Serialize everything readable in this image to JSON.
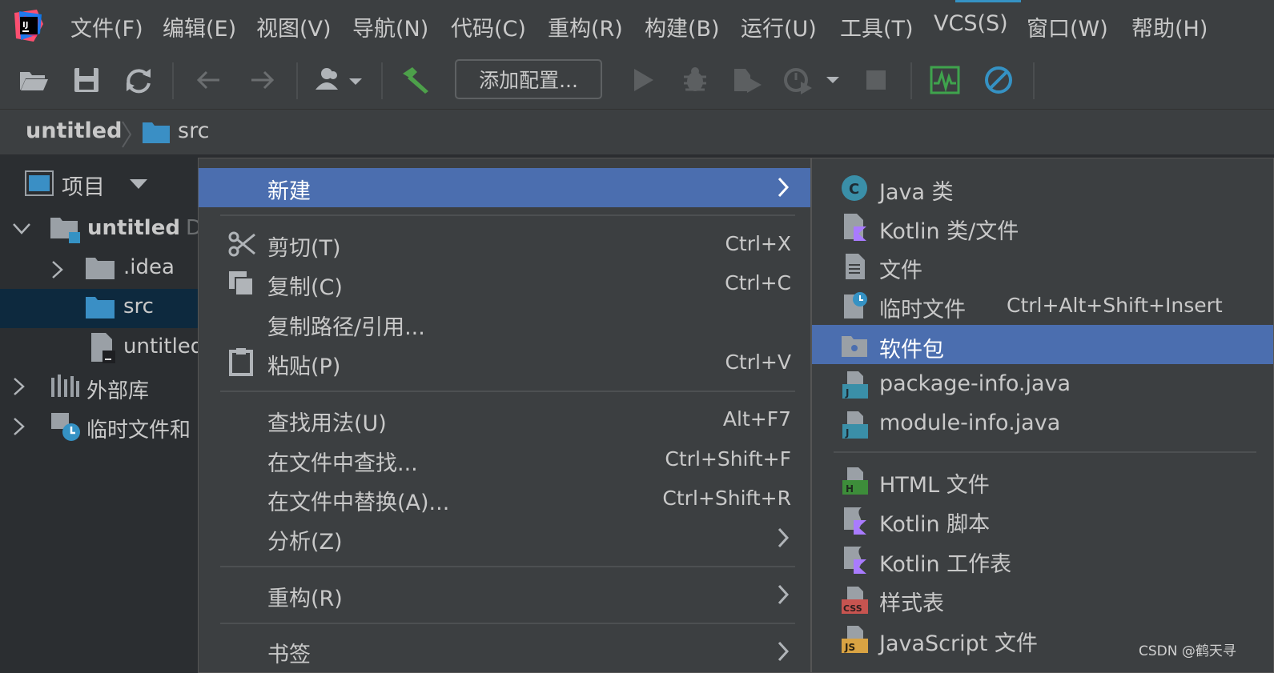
{
  "menubar": {
    "items": [
      "文件(F)",
      "编辑(E)",
      "视图(V)",
      "导航(N)",
      "代码(C)",
      "重构(R)",
      "构建(B)",
      "运行(U)",
      "工具(T)",
      "VCS(S)",
      "窗口(W)",
      "帮助(H)"
    ]
  },
  "toolbar": {
    "add_config_label": "添加配置...",
    "icons": [
      "open-folder-icon",
      "save-icon",
      "sync-icon",
      "back-arrow-icon",
      "forward-arrow-icon",
      "user-icon",
      "build-hammer-icon",
      "run-icon",
      "debug-icon",
      "coverage-icon",
      "profile-icon",
      "stop-icon",
      "monitor-icon",
      "power-save-icon"
    ]
  },
  "breadcrumb": {
    "project": "untitled",
    "folder": "src"
  },
  "project_panel": {
    "title": "项目",
    "tree": [
      {
        "label": "untitled",
        "suffix": "D"
      },
      {
        "label": ".idea"
      },
      {
        "label": "src"
      },
      {
        "label": "untitled"
      },
      {
        "label": "外部库"
      },
      {
        "label": "临时文件和"
      }
    ]
  },
  "context_menu": {
    "items": [
      {
        "label": "新建",
        "shortcut": "",
        "submenu": true
      },
      {
        "label": "剪切(T)",
        "shortcut": "Ctrl+X"
      },
      {
        "label": "复制(C)",
        "shortcut": "Ctrl+C"
      },
      {
        "label": "复制路径/引用...",
        "shortcut": ""
      },
      {
        "label": "粘贴(P)",
        "shortcut": "Ctrl+V"
      },
      {
        "label": "查找用法(U)",
        "shortcut": "Alt+F7"
      },
      {
        "label": "在文件中查找...",
        "shortcut": "Ctrl+Shift+F"
      },
      {
        "label": "在文件中替换(A)...",
        "shortcut": "Ctrl+Shift+R"
      },
      {
        "label": "分析(Z)",
        "shortcut": "",
        "submenu": true
      },
      {
        "label": "重构(R)",
        "shortcut": "",
        "submenu": true
      },
      {
        "label": "书签",
        "shortcut": "",
        "submenu": true
      }
    ]
  },
  "new_submenu": {
    "items": [
      {
        "label": "Java 类",
        "icon": "java-class-icon"
      },
      {
        "label": "Kotlin 类/文件",
        "icon": "kotlin-file-icon"
      },
      {
        "label": "文件",
        "icon": "file-icon"
      },
      {
        "label": "临时文件",
        "icon": "scratch-file-icon",
        "shortcut": "Ctrl+Alt+Shift+Insert"
      },
      {
        "label": "软件包",
        "icon": "package-icon"
      },
      {
        "label": "package-info.java",
        "icon": "java-file-icon"
      },
      {
        "label": "module-info.java",
        "icon": "java-file-icon"
      },
      {
        "label": "HTML 文件",
        "icon": "html-file-icon"
      },
      {
        "label": "Kotlin 脚本",
        "icon": "kotlin-script-icon"
      },
      {
        "label": "Kotlin 工作表",
        "icon": "kotlin-worksheet-icon"
      },
      {
        "label": "样式表",
        "icon": "css-file-icon"
      },
      {
        "label": "JavaScript 文件",
        "icon": "js-file-icon"
      }
    ]
  },
  "watermark": "CSDN @鹤天寻",
  "colors": {
    "highlight": "#4b6eaf",
    "background": "#3c3f41",
    "selection": "#0d293e"
  }
}
